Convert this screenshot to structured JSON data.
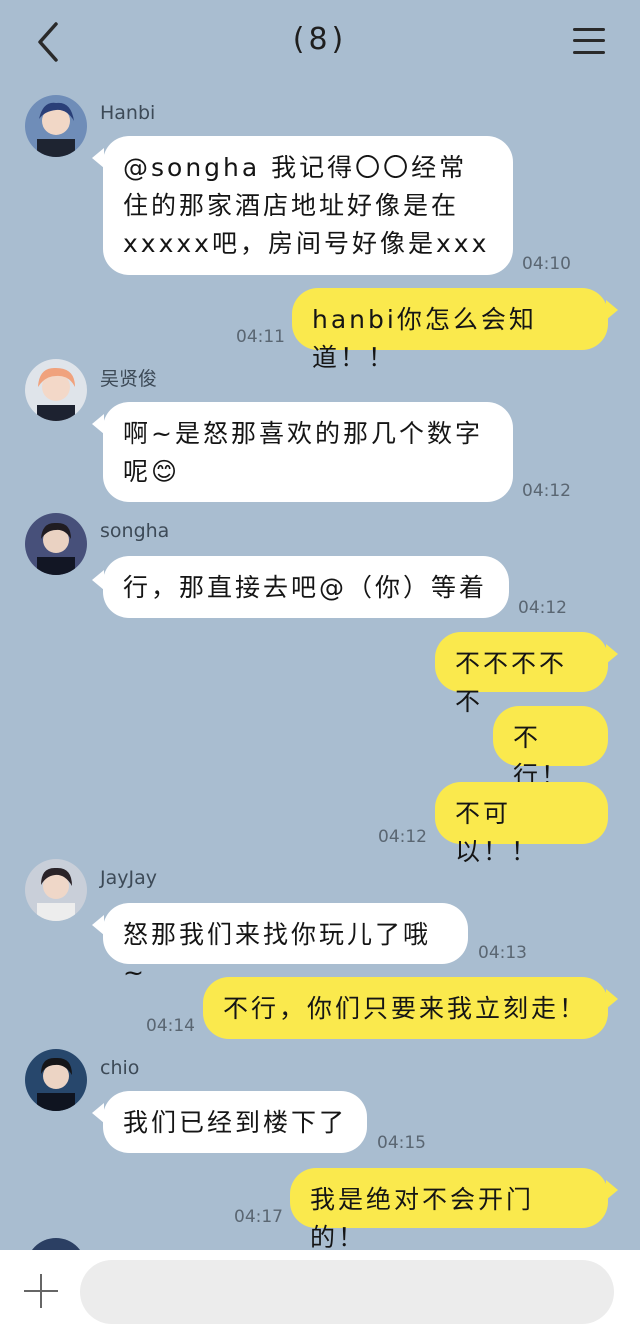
{
  "header": {
    "title": "(8)",
    "back_icon": "chevron-left-icon",
    "menu_icon": "hamburger-menu-icon"
  },
  "messages": [
    {
      "sender": "Hanbi",
      "text": "@songha 我记得〇〇经常住的那家酒店地址好像是在xxxxx吧，房间号好像是xxx",
      "time": "04:10"
    },
    {
      "text": "hanbi你怎么会知道！！",
      "time": "04:11"
    },
    {
      "sender": "吴贤俊",
      "text": "啊~是怒那喜欢的那几个数字呢😊",
      "time": "04:12"
    },
    {
      "sender": "songha",
      "text": "行，那直接去吧@（你）等着",
      "time": "04:12"
    },
    {
      "text": "不不不不不"
    },
    {
      "text": "不行！"
    },
    {
      "text": "不可以！！",
      "time": "04:12"
    },
    {
      "sender": "JayJay",
      "text": "怒那我们来找你玩儿了哦~",
      "time": "04:13"
    },
    {
      "text": "不行，你们只要来我立刻走！",
      "time": "04:14"
    },
    {
      "sender": "chio",
      "text": "我们已经到楼下了",
      "time": "04:15"
    },
    {
      "text": "我是绝对不会开门的！",
      "time": "04:17"
    }
  ],
  "input": {
    "placeholder": "",
    "plus_icon": "plus-icon"
  },
  "colors": {
    "background": "#a9bdd0",
    "own_bubble": "#fae94d",
    "other_bubble": "#ffffff"
  }
}
